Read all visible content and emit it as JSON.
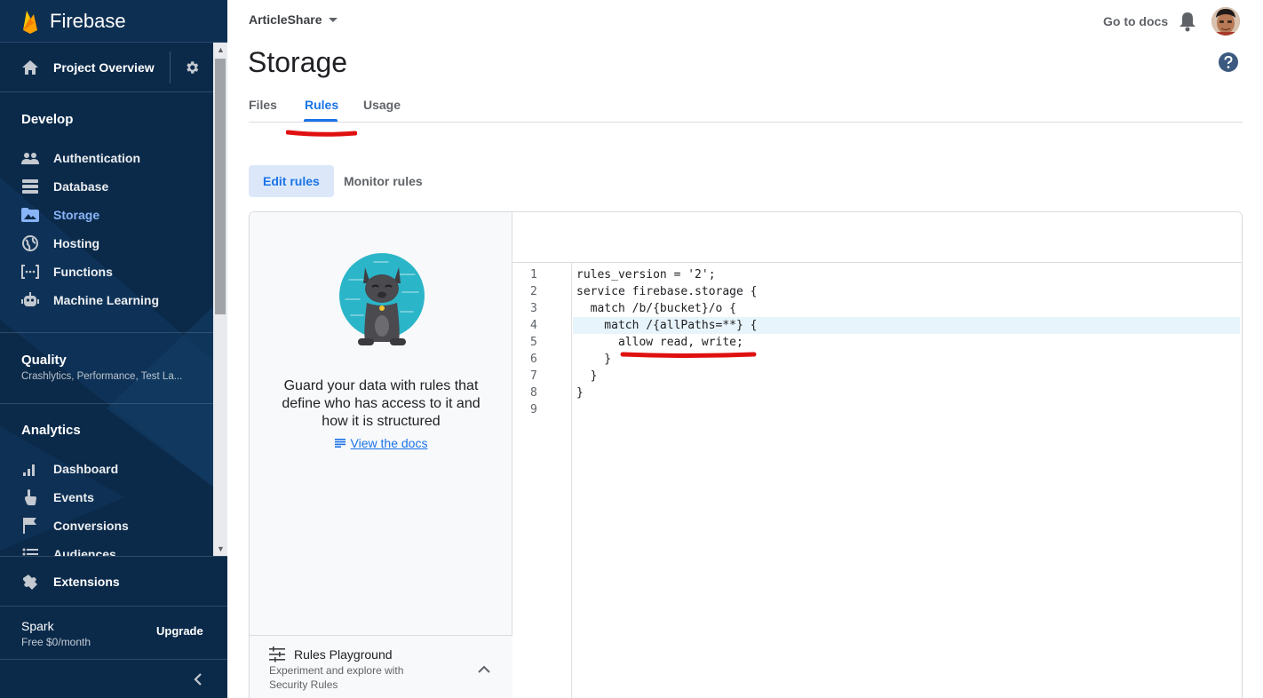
{
  "sidebar": {
    "brand": "Firebase",
    "project_overview": "Project Overview",
    "sections": {
      "develop": {
        "title": "Develop",
        "items": [
          {
            "label": "Authentication",
            "icon": "people-icon"
          },
          {
            "label": "Database",
            "icon": "database-icon"
          },
          {
            "label": "Storage",
            "icon": "storage-icon",
            "active": true
          },
          {
            "label": "Hosting",
            "icon": "globe-icon"
          },
          {
            "label": "Functions",
            "icon": "functions-icon"
          },
          {
            "label": "Machine Learning",
            "icon": "robot-icon"
          }
        ]
      },
      "quality": {
        "title": "Quality",
        "subtitle": "Crashlytics, Performance, Test La..."
      },
      "analytics": {
        "title": "Analytics",
        "items": [
          {
            "label": "Dashboard",
            "icon": "bar-chart-icon"
          },
          {
            "label": "Events",
            "icon": "touch-icon"
          },
          {
            "label": "Conversions",
            "icon": "flag-icon"
          },
          {
            "label": "Audiences",
            "icon": "list-icon"
          }
        ]
      }
    },
    "extensions": "Extensions",
    "plan": {
      "name": "Spark",
      "price": "Free $0/month",
      "upgrade": "Upgrade"
    }
  },
  "header": {
    "project": "ArticleShare",
    "go_to_docs": "Go to docs",
    "page_title": "Storage"
  },
  "tabs": [
    {
      "label": "Files"
    },
    {
      "label": "Rules",
      "active": true
    },
    {
      "label": "Usage"
    }
  ],
  "subtabs": {
    "edit": "Edit rules",
    "monitor": "Monitor rules"
  },
  "left_panel": {
    "guard_text": "Guard your data with rules that define who has access to it and how it is structured",
    "docs_link": "View the docs",
    "playground_title": "Rules Playground",
    "playground_desc": "Experiment and explore with Security Rules"
  },
  "editor": {
    "line_numbers": [
      "1",
      "2",
      "3",
      "4",
      "5",
      "6",
      "7",
      "8",
      "9"
    ],
    "lines": [
      "rules_version = '2';",
      "service firebase.storage {",
      "  match /b/{bucket}/o {",
      "    match /{allPaths=**} {",
      "      allow read, write;",
      "    }",
      "  }",
      "}",
      ""
    ],
    "highlighted_line": 4
  },
  "colors": {
    "sidebar_bg": "#0b2a4a",
    "accent": "#1a73e8",
    "active_nav": "#8ab4f8",
    "annotation_red": "#e01010",
    "firebase_orange": "#ffa000"
  }
}
